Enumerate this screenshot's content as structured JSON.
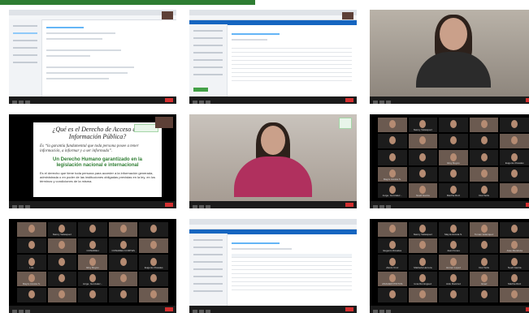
{
  "accent_color": "#2e7d32",
  "tiles": {
    "t1": {
      "type": "browser",
      "name": "screen-share-form"
    },
    "t2": {
      "type": "browser",
      "name": "screen-share-list"
    },
    "t3": {
      "type": "webcam",
      "name": "participant-woman-top"
    },
    "t4": {
      "type": "slide",
      "title": "¿Qué es el Derecho de Acceso a la Información Pública?",
      "quote": "Es “la garantía fundamental que toda persona posee a tener información, a informar y a ser informada”.",
      "subtitle": "Un Derecho Humano garantizado en la legislación nacional e internacional",
      "body": "Es el derecho que tiene toda persona para acceder a la información generada, administrada o en poder de las instituciones obligadas previstas en la ley, en los términos y condiciones de la misma."
    },
    "t5": {
      "type": "webcam",
      "name": "speaker-woman-center"
    },
    "t6": {
      "type": "gallery",
      "names": [
        "",
        "Nancy Velasquez",
        "",
        "",
        "",
        "",
        "",
        "",
        "",
        "",
        "",
        "",
        "Eloy Reyes",
        "",
        "Eugenio Rosales",
        "Mayra Acosta S.",
        "",
        "",
        "",
        "",
        "Jorge. Gonzalez...",
        "Noell Garcia",
        "Martha Ruiz",
        "Itzel Solis",
        ""
      ]
    },
    "t7": {
      "type": "gallery",
      "names": [
        "",
        "Nancy Velasquez",
        "",
        "",
        "",
        "",
        "",
        "CONADEH",
        "CONADEH CORTES",
        "",
        "Luis",
        "",
        "Eloy Reyes",
        "",
        "Eugenio Rosales",
        "Mayra Acosta S.",
        "",
        "Jorge. Gonzalez...",
        "",
        "",
        "",
        "",
        "",
        "",
        ""
      ]
    },
    "t8": {
      "type": "browser",
      "name": "screen-share-table"
    },
    "t9": {
      "type": "gallery",
      "names": [
        "",
        "Nancy Velasquez",
        "Mayra Acosta S.",
        "Tomas Velazquez",
        "",
        "Eugenio Rosales",
        "",
        "Juan Funes",
        "",
        "Jose Mendoza",
        "Alexis Cruz",
        "Marisela Herrera",
        "Jenner Lopez",
        "Itzel Solis",
        "Noell Garcia",
        "ANAHERI PINTOS",
        "Iona Dominguez",
        "Julio Ramirez",
        "Israel",
        "Martha Ruiz",
        "",
        "",
        "",
        "",
        ""
      ]
    }
  }
}
